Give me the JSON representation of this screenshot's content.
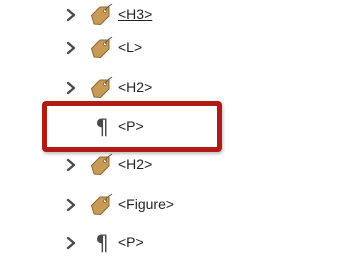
{
  "tree": {
    "rows": [
      {
        "label": "<H3>",
        "icon": "tag-icon",
        "has_chevron": true
      },
      {
        "label": "<L>",
        "icon": "tag-icon",
        "has_chevron": true
      },
      {
        "label": "<H2>",
        "icon": "tag-icon",
        "has_chevron": true
      },
      {
        "label": "<P>",
        "icon": "paragraph-icon",
        "icon_glyph": "¶",
        "has_chevron": false,
        "highlighted": true
      },
      {
        "label": "<H2>",
        "icon": "tag-icon",
        "has_chevron": true
      },
      {
        "label": "<Figure>",
        "icon": "tag-icon",
        "has_chevron": true
      },
      {
        "label": "<P>",
        "icon": "paragraph-icon",
        "icon_glyph": "¶",
        "has_chevron": true
      }
    ]
  },
  "colors": {
    "tag_fill": "#c79a55",
    "tag_stroke": "#8a6a35",
    "chevron": "#4a4a4a",
    "highlight_border": "#b01c14",
    "text": "#222222"
  }
}
